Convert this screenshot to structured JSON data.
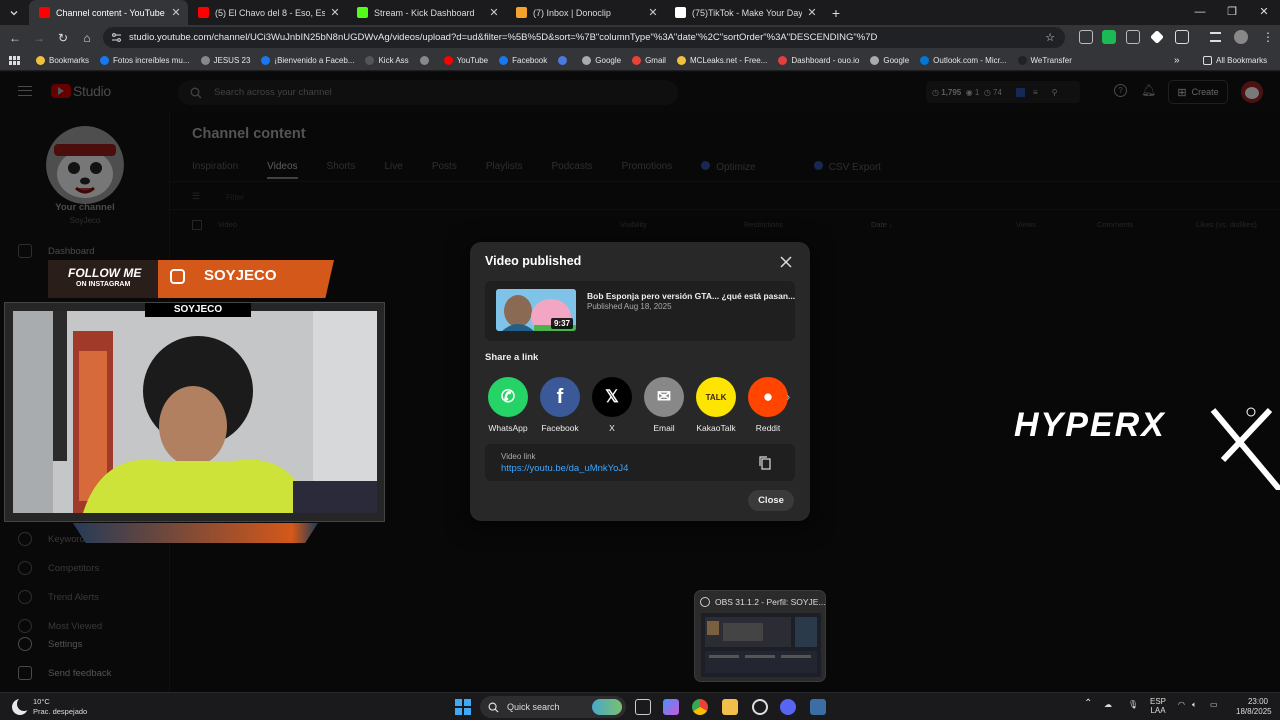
{
  "browser": {
    "tabs": [
      {
        "title": "Channel content - YouTube Studio",
        "icon": "youtube-icon",
        "color": "#ff0000",
        "active": true
      },
      {
        "title": "(5) El Chavo del 8 - Eso, Eso, Eso",
        "icon": "youtube-icon",
        "color": "#ff0000",
        "active": false
      },
      {
        "title": "Stream - Kick Dashboard",
        "icon": "kick-icon",
        "color": "#53fc18",
        "active": false
      },
      {
        "title": "(7) Inbox | Donoclip",
        "icon": "donoclip-icon",
        "color": "#f4a32d",
        "active": false
      },
      {
        "title": "(75)TikTok - Make Your Day",
        "icon": "tiktok-icon",
        "color": "#ffffff",
        "active": false
      }
    ],
    "url": "studio.youtube.com/channel/UCi3WuJnbIN25bN8nUGDWvAg/videos/upload?d=ud&filter=%5B%5D&sort=%7B\"columnType\"%3A\"date\"%2C\"sortOrder\"%3A\"DESCENDING\"%7D",
    "bookmarks": [
      "Bookmarks",
      "Fotos increíbles mu...",
      "JESUS 23",
      "¡Bienvenido a Faceb...",
      "Kick Ass",
      "",
      "YouTube",
      "Facebook",
      "",
      "Google",
      "Gmail",
      "MCLeaks.net - Free...",
      "Dashboard - ouo.io",
      "Google",
      "Outlook.com - Micr...",
      "WeTransfer"
    ],
    "all_bookmarks": "All Bookmarks"
  },
  "studio": {
    "logo": "Studio",
    "search_placeholder": "Search across your channel",
    "stats": {
      "views": "1,795",
      "a": "1",
      "b": "74"
    },
    "create_label": "Create",
    "your_channel": "Your channel",
    "channel_handle": "SoyJeco",
    "sidebar": [
      "Dashboard",
      "Keywords",
      "Competitors",
      "Trend Alerts",
      "Most Viewed",
      "Settings",
      "Send feedback"
    ],
    "page_title": "Channel content",
    "tabs": [
      "Inspiration",
      "Videos",
      "Shorts",
      "Live",
      "Posts",
      "Playlists",
      "Podcasts",
      "Promotions",
      "Optimize",
      "CSV Export"
    ],
    "filter_label": "Filter",
    "columns": [
      "Video",
      "Visibility",
      "Restrictions",
      "Date ↓",
      "Views",
      "Comments",
      "Likes (vs. dislikes)"
    ]
  },
  "dialog": {
    "title": "Video published",
    "video_title": "Bob Esponja pero versión GTA... ¿qué está pasan...",
    "video_date": "Published Aug 18, 2025",
    "duration": "9:37",
    "share_label": "Share a link",
    "share_targets": [
      {
        "label": "WhatsApp",
        "color": "#25d366"
      },
      {
        "label": "Facebook",
        "color": "#3b5998"
      },
      {
        "label": "X",
        "color": "#000000"
      },
      {
        "label": "Email",
        "color": "#888888"
      },
      {
        "label": "KakaoTalk",
        "color": "#fee500"
      },
      {
        "label": "Reddit",
        "color": "#ff4500"
      }
    ],
    "link_label": "Video link",
    "link": "https://youtu.be/da_uMnkYoJ4",
    "close_label": "Close"
  },
  "overlay": {
    "follow_line1": "FOLLOW ME",
    "follow_line2": "ON INSTAGRAM",
    "handle": "SOYJECO",
    "cam_label": "SOYJECO",
    "brand": "HYPERX"
  },
  "taskbar": {
    "temp": "10°C",
    "weather": "Prac. despejado",
    "search": "Quick search",
    "obs_title": "OBS 31.1.2 - Perfil: SOYJE...",
    "lang1": "ESP",
    "lang2": "LAA",
    "time": "23:00",
    "date": "18/8/2025"
  }
}
